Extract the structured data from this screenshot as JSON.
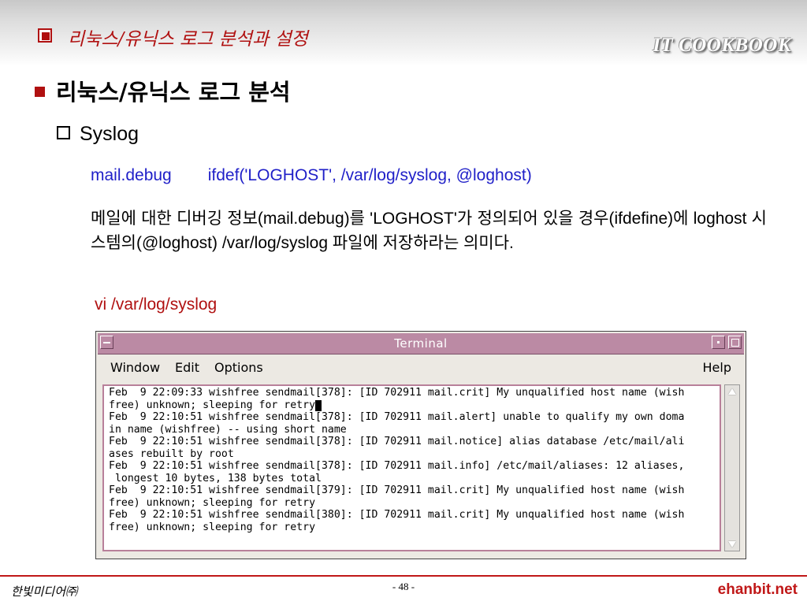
{
  "header": {
    "title": "리눅스/유닉스 로그 분석과 설정",
    "brand": "IT COOKBOOK"
  },
  "heading1": "리눅스/유닉스 로그 분석",
  "heading2": "Syslog",
  "config_line": {
    "facility": "mail.debug",
    "action": "ifdef('LOGHOST', /var/log/syslog, @loghost)"
  },
  "description": "메일에 대한 디버깅 정보(mail.debug)를 'LOGHOST'가 정의되어 있을 경우(ifdefine)에 loghost 시스템의(@loghost) /var/log/syslog 파일에 저장하라는 의미다.",
  "command": "vi /var/log/syslog",
  "terminal": {
    "title": "Terminal",
    "menus": [
      "Window",
      "Edit",
      "Options",
      "Help"
    ],
    "lines": [
      "Feb  9 22:09:33 wishfree sendmail[378]: [ID 702911 mail.crit] My unqualified host name (wish",
      "free) unknown; sleeping for retry",
      "Feb  9 22:10:51 wishfree sendmail[378]: [ID 702911 mail.alert] unable to qualify my own doma",
      "in name (wishfree) -- using short name",
      "Feb  9 22:10:51 wishfree sendmail[378]: [ID 702911 mail.notice] alias database /etc/mail/ali",
      "ases rebuilt by root",
      "Feb  9 22:10:51 wishfree sendmail[378]: [ID 702911 mail.info] /etc/mail/aliases: 12 aliases,",
      " longest 10 bytes, 138 bytes total",
      "Feb  9 22:10:51 wishfree sendmail[379]: [ID 702911 mail.crit] My unqualified host name (wish",
      "free) unknown; sleeping for retry",
      "Feb  9 22:10:51 wishfree sendmail[380]: [ID 702911 mail.crit] My unqualified host name (wish",
      "free) unknown; sleeping for retry"
    ]
  },
  "footer": {
    "page": "- 48 -",
    "publisher": "한빛미디어㈜",
    "site": "ehanbit.net"
  }
}
